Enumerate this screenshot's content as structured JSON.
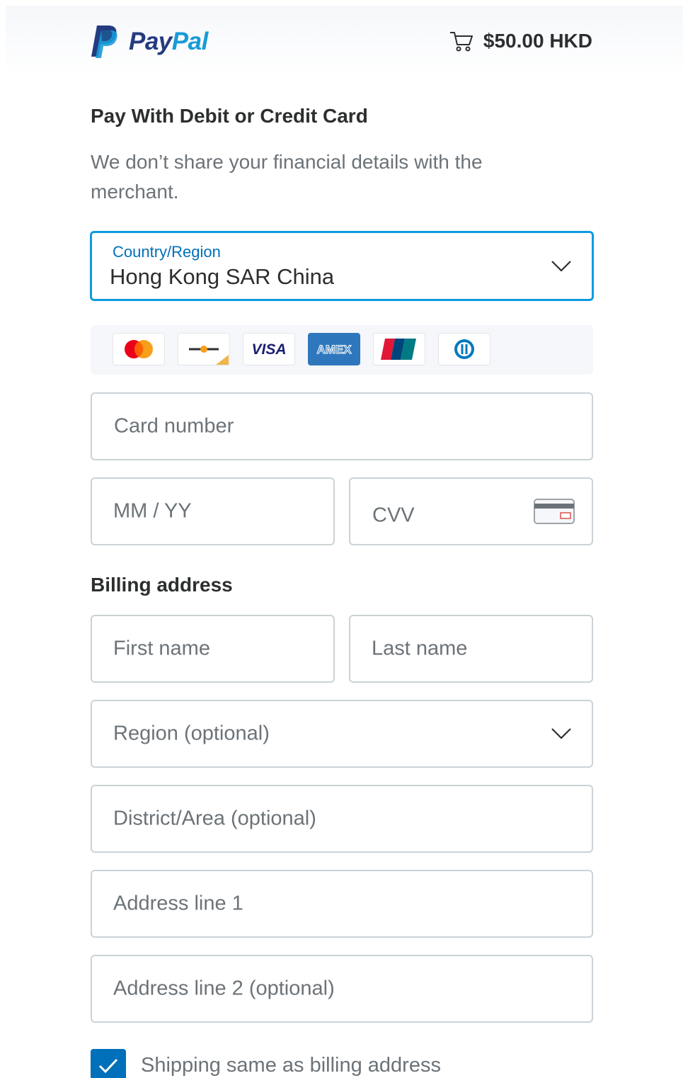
{
  "header": {
    "logo_pay": "Pay",
    "logo_pal": "Pal",
    "cart_amount": "$50.00 HKD"
  },
  "form": {
    "title": "Pay With Debit or Credit Card",
    "subtitle": "We don’t share your financial details with the merchant.",
    "country": {
      "label": "Country/Region",
      "value": "Hong Kong SAR China"
    },
    "card_brands": [
      "mastercard",
      "maestro",
      "visa",
      "amex",
      "unionpay",
      "diners"
    ],
    "card_number_placeholder": "Card number",
    "expiry_placeholder": "MM / YY",
    "cvv_placeholder": "CVV",
    "billing_title": "Billing address",
    "first_name_placeholder": "First name",
    "last_name_placeholder": "Last name",
    "region_placeholder": "Region (optional)",
    "district_placeholder": "District/Area (optional)",
    "address1_placeholder": "Address line 1",
    "address2_placeholder": "Address line 2 (optional)",
    "shipping_same_label": "Shipping same as billing address",
    "shipping_same_checked": true
  },
  "colors": {
    "accent": "#0070ba",
    "focus": "#0d9ae0",
    "logo_dark": "#253b80",
    "logo_light": "#179bd7"
  }
}
